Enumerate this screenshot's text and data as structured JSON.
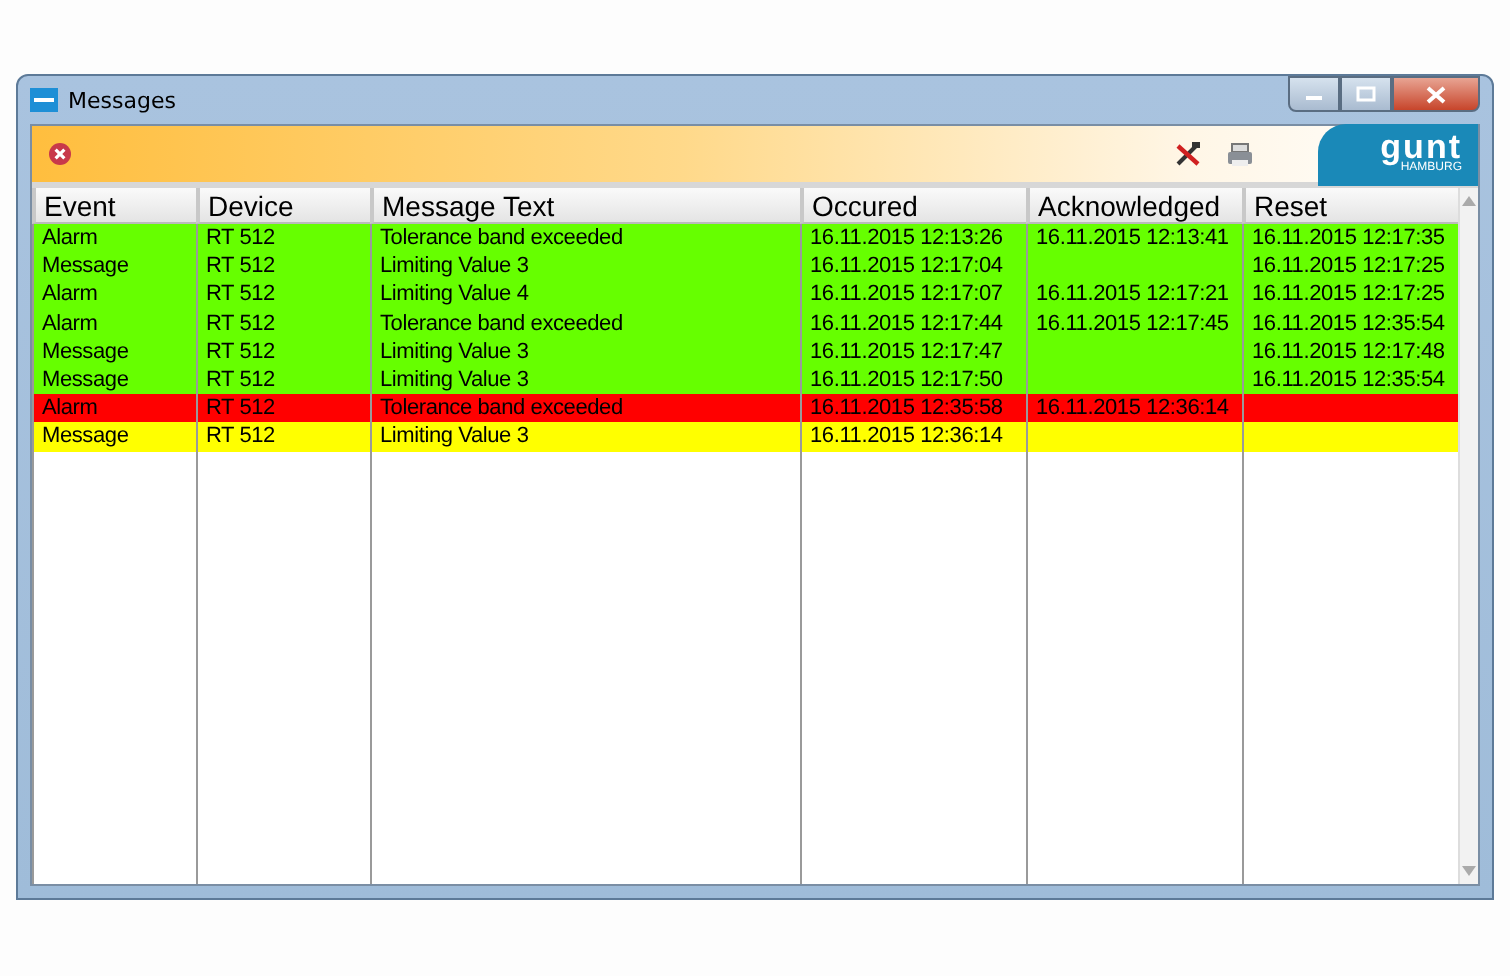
{
  "window": {
    "title": "Messages"
  },
  "logo": {
    "text": "gunt",
    "subtext": "HAMBURG"
  },
  "table": {
    "columns": [
      "Event",
      "Device",
      "Message Text",
      "Occured",
      "Acknowledged",
      "Reset"
    ],
    "rows": [
      {
        "color": "#66ff00",
        "cells": [
          "Alarm",
          "RT 512",
          "Tolerance band exceeded",
          "16.11.2015 12:13:26",
          "16.11.2015 12:13:41",
          "16.11.2015 12:17:35"
        ]
      },
      {
        "color": "#66ff00",
        "cells": [
          "Message",
          "RT 512",
          "Limiting Value 3",
          "16.11.2015 12:17:04",
          "",
          "16.11.2015 12:17:25"
        ]
      },
      {
        "color": "#66ff00",
        "cells": [
          "Alarm",
          "RT 512",
          "Limiting Value 4",
          "16.11.2015 12:17:07",
          "16.11.2015 12:17:21",
          "16.11.2015 12:17:25"
        ]
      },
      {
        "color": "#66ff00",
        "cells": [
          "Alarm",
          "RT 512",
          "Tolerance band exceeded",
          "16.11.2015 12:17:44",
          "16.11.2015 12:17:45",
          "16.11.2015 12:35:54"
        ]
      },
      {
        "color": "#66ff00",
        "cells": [
          "Message",
          "RT 512",
          "Limiting Value 3",
          "16.11.2015 12:17:47",
          "",
          "16.11.2015 12:17:48"
        ]
      },
      {
        "color": "#66ff00",
        "cells": [
          "Message",
          "RT 512",
          "Limiting Value 3",
          "16.11.2015 12:17:50",
          "",
          "16.11.2015 12:35:54"
        ]
      },
      {
        "color": "#ff0000",
        "cells": [
          "Alarm",
          "RT 512",
          "Tolerance band exceeded",
          "16.11.2015 12:35:58",
          "16.11.2015 12:36:14",
          ""
        ]
      },
      {
        "color": "#ffff00",
        "cells": [
          "Message",
          "RT 512",
          "Limiting Value 3",
          "16.11.2015 12:36:14",
          "",
          ""
        ]
      }
    ]
  }
}
